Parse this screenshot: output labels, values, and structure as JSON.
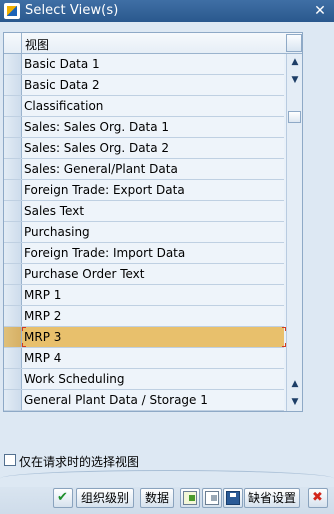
{
  "window": {
    "title": "Select View(s)"
  },
  "table": {
    "column_header": "视图",
    "rows": [
      "Basic Data 1",
      "Basic Data 2",
      "Classification",
      "Sales: Sales Org. Data 1",
      "Sales: Sales Org. Data 2",
      "Sales: General/Plant Data",
      "Foreign Trade: Export Data",
      "Sales Text",
      "Purchasing",
      "Foreign Trade: Import Data",
      "Purchase Order Text",
      "MRP 1",
      "MRP 2",
      "MRP 3",
      "MRP 4",
      "Work Scheduling",
      "General Plant Data / Storage 1"
    ],
    "selected_index": 13
  },
  "option": {
    "label": "仅在请求时的选择视图",
    "checked": false
  },
  "toolbar": {
    "org_levels_label": "组织级别",
    "data_label": "数据",
    "default_values_label": "缺省设置"
  },
  "colors": {
    "selected_row": "#e8c06c",
    "title_bar": "#2f5f96"
  }
}
